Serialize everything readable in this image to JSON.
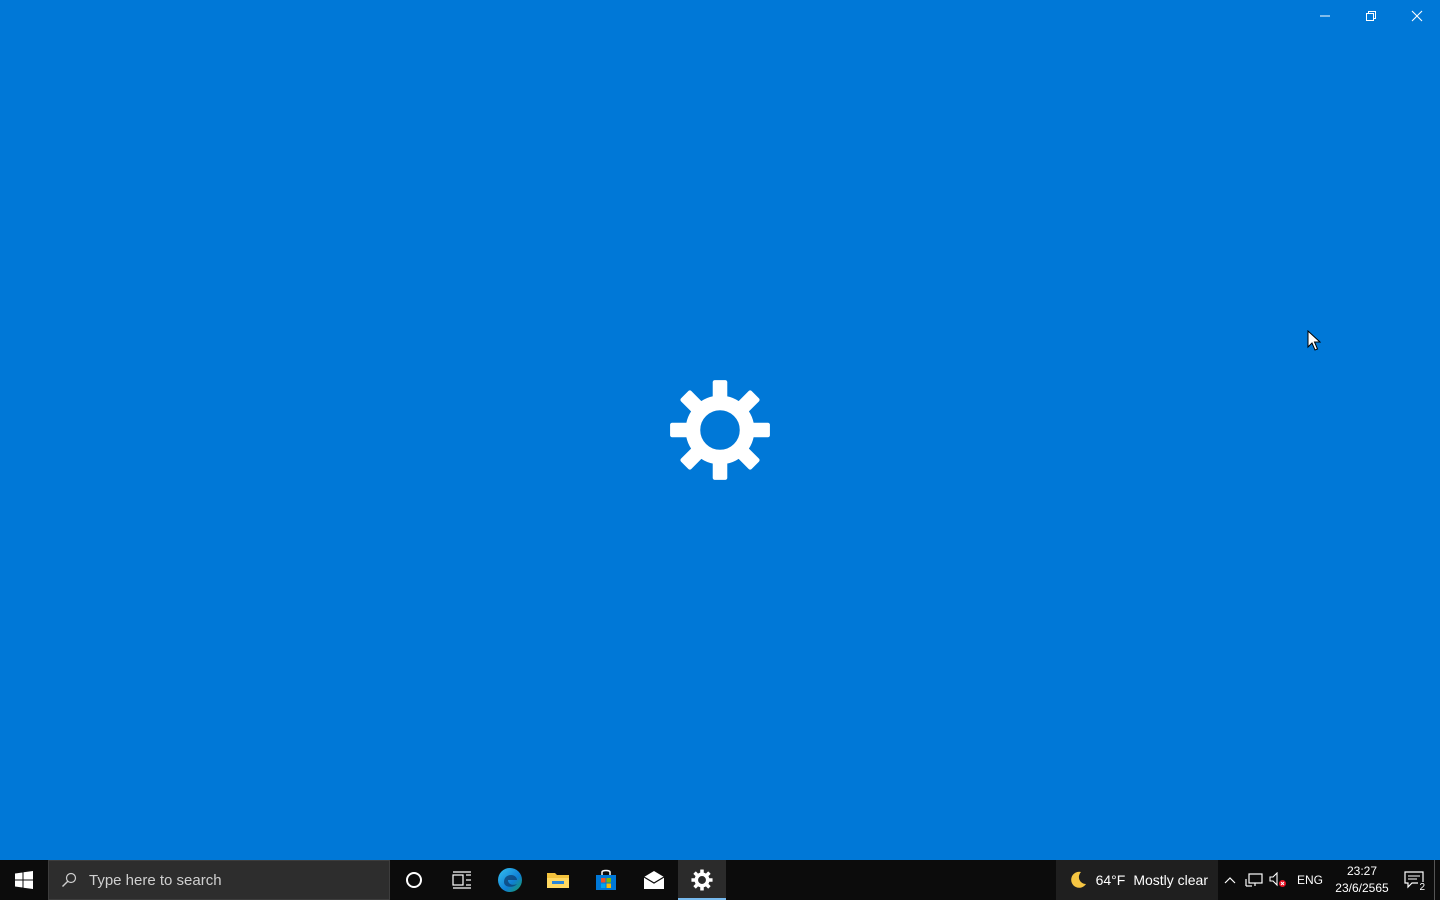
{
  "window": {
    "background_color": "#0078d7",
    "caption_buttons": [
      "minimize",
      "restore",
      "close"
    ]
  },
  "splash": {
    "icon": "gear-icon"
  },
  "taskbar": {
    "search": {
      "placeholder": "Type here to search"
    },
    "pinned_apps": [
      {
        "name": "cortana-icon"
      },
      {
        "name": "task-view-icon"
      },
      {
        "name": "edge-icon"
      },
      {
        "name": "file-explorer-icon"
      },
      {
        "name": "microsoft-store-icon"
      },
      {
        "name": "mail-icon"
      },
      {
        "name": "settings-icon",
        "active": true
      }
    ],
    "weather": {
      "temperature": "64°F",
      "condition": "Mostly clear"
    },
    "tray": {
      "language": "ENG",
      "time": "23:27",
      "date": "23/6/2565",
      "notification_count": "2"
    }
  }
}
